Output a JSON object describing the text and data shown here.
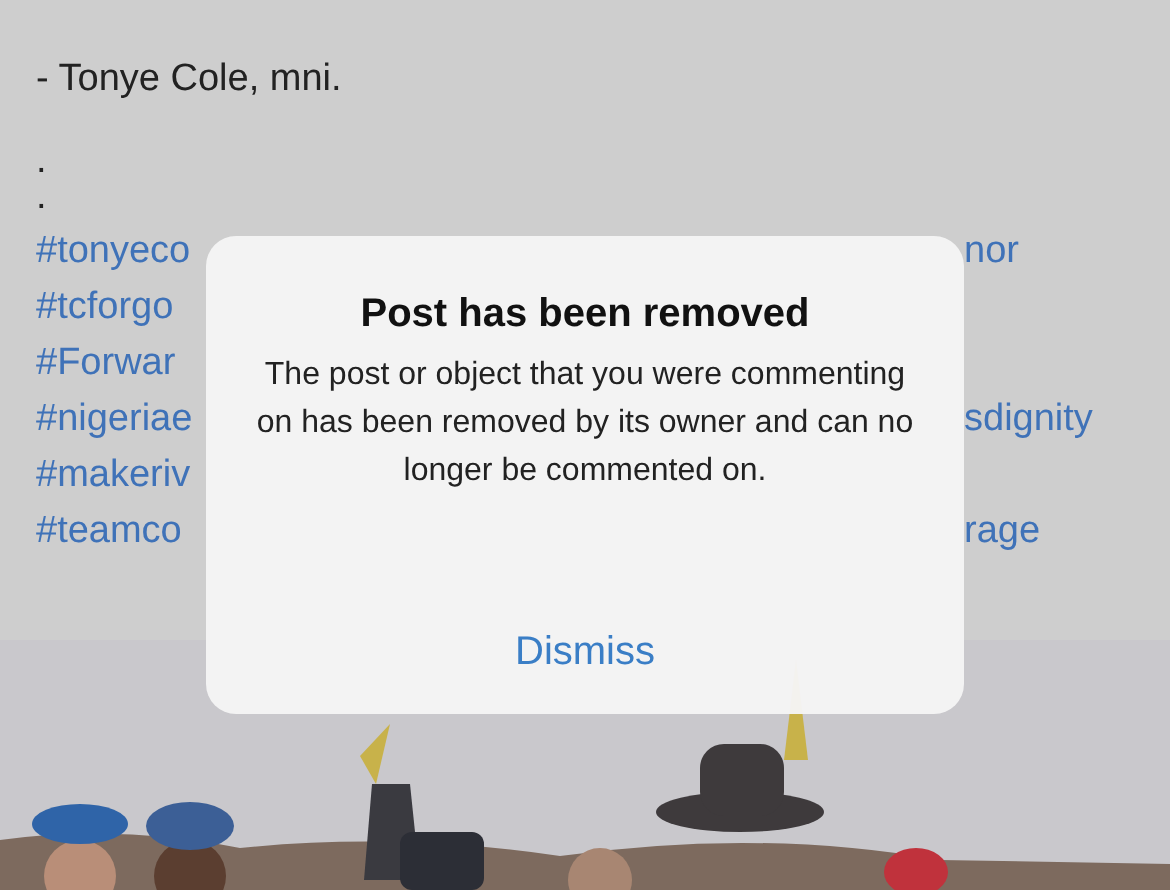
{
  "post": {
    "author_line": "- Tonye Cole, mni.",
    "dots": [
      ".",
      "."
    ],
    "hashtag_rows": [
      {
        "left": "#tonyeco",
        "right": "nor"
      },
      {
        "left": "#tcforgo"
      },
      {
        "left": "#Forwar"
      },
      {
        "left": "#nigeriae",
        "right": "sdignity"
      },
      {
        "left": "#makeriv"
      },
      {
        "left": "#teamco",
        "right": "rage"
      }
    ]
  },
  "dialog": {
    "title": "Post has been removed",
    "message": "The post or object that you were commenting on has been removed by its owner and can no longer be commented on.",
    "button": "Dismiss"
  }
}
